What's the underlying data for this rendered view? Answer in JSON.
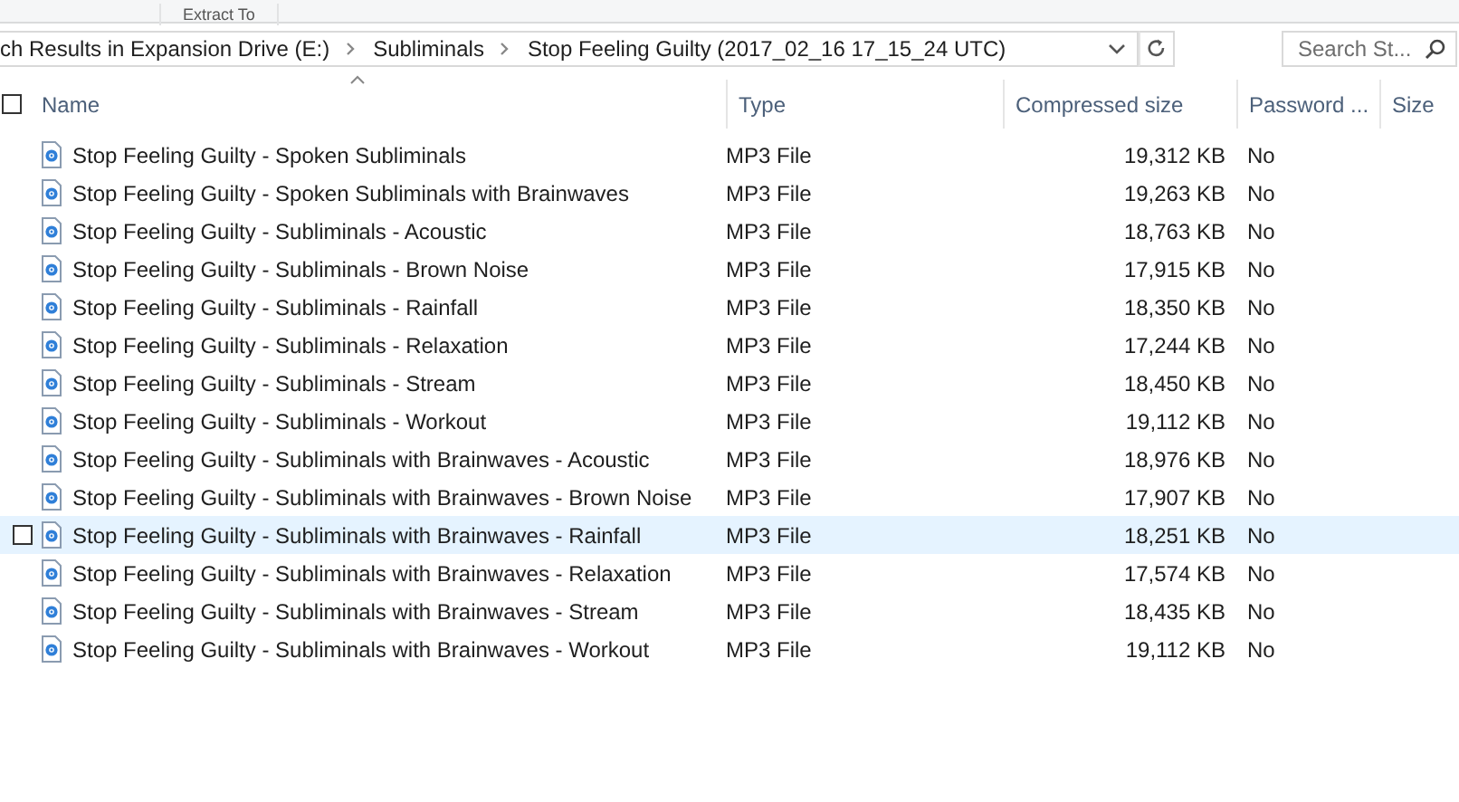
{
  "ribbon": {
    "label": "Extract To"
  },
  "address_bar": {
    "breadcrumbs": [
      "ch Results in Expansion Drive (E:)",
      "Subliminals",
      "Stop Feeling Guilty (2017_02_16 17_15_24 UTC)"
    ]
  },
  "search": {
    "placeholder": "Search St..."
  },
  "select_all": {
    "checked": false
  },
  "table": {
    "columns": [
      {
        "label": "Name",
        "sorted": true
      },
      {
        "label": "Type",
        "sorted": false
      },
      {
        "label": "Compressed size",
        "sorted": false
      },
      {
        "label": "Password ...",
        "sorted": false
      },
      {
        "label": "Size",
        "sorted": false
      }
    ],
    "rows": [
      {
        "name": "Stop Feeling Guilty - Spoken Subliminals",
        "type": "MP3 File",
        "compressed_size": "19,312 KB",
        "password": "No",
        "hovered": false
      },
      {
        "name": "Stop Feeling Guilty - Spoken Subliminals with Brainwaves",
        "type": "MP3 File",
        "compressed_size": "19,263 KB",
        "password": "No",
        "hovered": false
      },
      {
        "name": "Stop Feeling Guilty - Subliminals - Acoustic",
        "type": "MP3 File",
        "compressed_size": "18,763 KB",
        "password": "No",
        "hovered": false
      },
      {
        "name": "Stop Feeling Guilty - Subliminals - Brown Noise",
        "type": "MP3 File",
        "compressed_size": "17,915 KB",
        "password": "No",
        "hovered": false
      },
      {
        "name": "Stop Feeling Guilty - Subliminals - Rainfall",
        "type": "MP3 File",
        "compressed_size": "18,350 KB",
        "password": "No",
        "hovered": false
      },
      {
        "name": "Stop Feeling Guilty - Subliminals - Relaxation",
        "type": "MP3 File",
        "compressed_size": "17,244 KB",
        "password": "No",
        "hovered": false
      },
      {
        "name": "Stop Feeling Guilty - Subliminals - Stream",
        "type": "MP3 File",
        "compressed_size": "18,450 KB",
        "password": "No",
        "hovered": false
      },
      {
        "name": "Stop Feeling Guilty - Subliminals - Workout",
        "type": "MP3 File",
        "compressed_size": "19,112 KB",
        "password": "No",
        "hovered": false
      },
      {
        "name": "Stop Feeling Guilty - Subliminals with Brainwaves - Acoustic",
        "type": "MP3 File",
        "compressed_size": "18,976 KB",
        "password": "No",
        "hovered": false
      },
      {
        "name": "Stop Feeling Guilty - Subliminals with Brainwaves - Brown Noise",
        "type": "MP3 File",
        "compressed_size": "17,907 KB",
        "password": "No",
        "hovered": false
      },
      {
        "name": "Stop Feeling Guilty - Subliminals with Brainwaves - Rainfall",
        "type": "MP3 File",
        "compressed_size": "18,251 KB",
        "password": "No",
        "hovered": true
      },
      {
        "name": "Stop Feeling Guilty - Subliminals with Brainwaves - Relaxation",
        "type": "MP3 File",
        "compressed_size": "17,574 KB",
        "password": "No",
        "hovered": false
      },
      {
        "name": "Stop Feeling Guilty - Subliminals with Brainwaves - Stream",
        "type": "MP3 File",
        "compressed_size": "18,435 KB",
        "password": "No",
        "hovered": false
      },
      {
        "name": "Stop Feeling Guilty - Subliminals with Brainwaves - Workout",
        "type": "MP3 File",
        "compressed_size": "19,112 KB",
        "password": "No",
        "hovered": false
      }
    ]
  }
}
